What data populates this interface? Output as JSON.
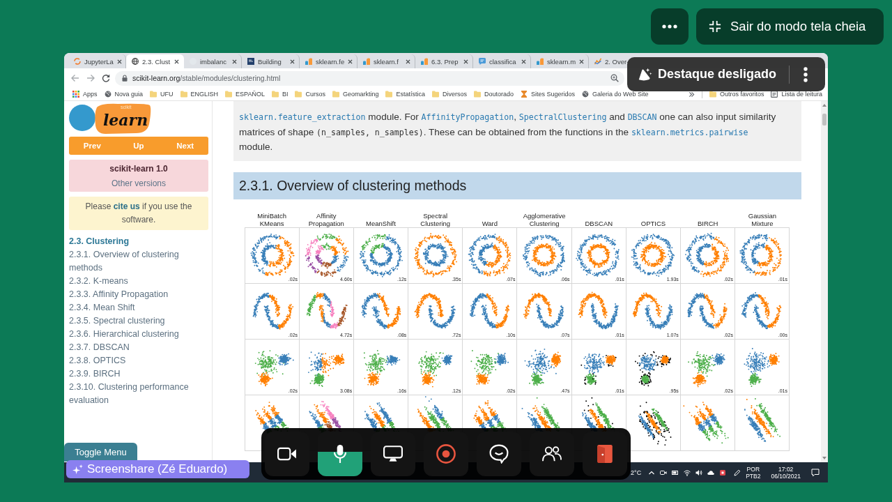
{
  "meeting": {
    "exit_fullscreen": "Sair do modo tela cheia",
    "spotlight": "Destaque desligado",
    "presenter": "Screenshare (Zé Eduardo)",
    "controls": [
      {
        "kind": "camera",
        "on": false
      },
      {
        "kind": "microphone",
        "on": true
      },
      {
        "kind": "screen",
        "on": false
      },
      {
        "kind": "record",
        "on": false
      },
      {
        "kind": "chat",
        "on": false
      },
      {
        "kind": "participants",
        "on": false
      },
      {
        "kind": "leave",
        "on": false
      }
    ]
  },
  "browser": {
    "tabs": [
      {
        "kind": "ring",
        "title": "JupyterLa",
        "selected": false
      },
      {
        "kind": "globe",
        "title": "2.3. Clust",
        "selected": true
      },
      {
        "kind": "disc",
        "title": "imbalanc",
        "selected": false
      },
      {
        "kind": "tile",
        "title": "Building",
        "selected": false
      },
      {
        "kind": "bars",
        "title": "sklearn.fe",
        "selected": false
      },
      {
        "kind": "bars",
        "title": "sklearn.f",
        "selected": false
      },
      {
        "kind": "bars",
        "title": "6.3. Prep",
        "selected": false
      },
      {
        "kind": "bubble",
        "title": "classifica",
        "selected": false
      },
      {
        "kind": "bars",
        "title": "sklearn.m",
        "selected": false
      },
      {
        "kind": "chart",
        "title": "2. Over-",
        "selected": false
      }
    ],
    "address": {
      "domain": "scikit-learn.org",
      "path": "/stable/modules/clustering.html"
    },
    "bookmarks": [
      {
        "kind": "apps",
        "label": "Apps"
      },
      {
        "kind": "globe",
        "label": "Nova guia"
      },
      {
        "kind": "folder",
        "label": "UFU"
      },
      {
        "kind": "folder",
        "label": "ENGLISH"
      },
      {
        "kind": "folder",
        "label": "ESPAÑOL"
      },
      {
        "kind": "folder",
        "label": "BI"
      },
      {
        "kind": "folder",
        "label": "Cursos"
      },
      {
        "kind": "folder",
        "label": "Geomarkting"
      },
      {
        "kind": "folder",
        "label": "Estatística"
      },
      {
        "kind": "folder",
        "label": "Diversos"
      },
      {
        "kind": "folder",
        "label": "Doutorado"
      },
      {
        "kind": "hourglass",
        "label": "Sites Sugeridos"
      },
      {
        "kind": "globe",
        "label": "Galeria do Web Site"
      }
    ],
    "bookmarks_right": [
      {
        "kind": "folder",
        "label": "Outros favoritos"
      },
      {
        "kind": "reading-list",
        "label": "Lista de leitura"
      }
    ]
  },
  "page": {
    "logo": {
      "small": "scikit",
      "name": "learn"
    },
    "nav": [
      "Prev",
      "Up",
      "Next"
    ],
    "version": {
      "title": "scikit-learn 1.0",
      "link": "Other versions"
    },
    "cite": {
      "before": "Please ",
      "link": "cite us",
      "after": " if you use the software."
    },
    "toc": [
      {
        "label": "2.3. Clustering",
        "selected": true,
        "children": [
          {
            "label": "2.3.1. Overview of clustering methods",
            "selected": false
          },
          {
            "label": "2.3.2. K-means",
            "selected": false
          },
          {
            "label": "2.3.3. Affinity Propagation",
            "selected": false
          },
          {
            "label": "2.3.4. Mean Shift",
            "selected": false
          },
          {
            "label": "2.3.5. Spectral clustering",
            "selected": false
          },
          {
            "label": "2.3.6. Hierarchical clustering",
            "selected": false
          },
          {
            "label": "2.3.7. DBSCAN",
            "selected": false
          },
          {
            "label": "2.3.8. OPTICS",
            "selected": false
          },
          {
            "label": "2.3.9. BIRCH",
            "selected": false
          },
          {
            "label": "2.3.10. Clustering performance evaluation",
            "selected": false
          }
        ]
      }
    ],
    "toggle_menu": "Toggle Menu",
    "intro": [
      {
        "kind": "code-link",
        "text": "sklearn.feature_extraction"
      },
      {
        "kind": "text",
        "text": " module. For "
      },
      {
        "kind": "code-link",
        "text": "AffinityPropagation"
      },
      {
        "kind": "text",
        "text": ", "
      },
      {
        "kind": "code-link",
        "text": "SpectralClustering"
      },
      {
        "kind": "text",
        "text": " and "
      },
      {
        "kind": "code-link",
        "text": "DBSCAN"
      },
      {
        "kind": "text",
        "text": " one can also input similarity matrices of shape "
      },
      {
        "kind": "code",
        "text": "(n_samples, n_samples)"
      },
      {
        "kind": "text",
        "text": ". These can be obtained from the functions in the "
      },
      {
        "kind": "code-link",
        "text": "sklearn.metrics.pairwise"
      },
      {
        "kind": "text",
        "text": " module."
      }
    ],
    "section_title": "2.3.1. Overview of clustering methods",
    "comparison": {
      "methods": [
        "MiniBatch KMeans",
        "Affinity Propagation",
        "MeanShift",
        "Spectral Clustering",
        "Ward",
        "Agglomerative Clustering",
        "DBSCAN",
        "OPTICS",
        "BIRCH",
        "Gaussian Mixture"
      ],
      "rows": [
        {
          "kind": "rings",
          "times": [
            ".02s",
            "4.60s",
            ".12s",
            ".35s",
            ".07s",
            ".06s",
            ".01s",
            "1.93s",
            ".02s",
            ".01s"
          ]
        },
        {
          "kind": "moons",
          "times": [
            ".02s",
            "4.72s",
            ".08s",
            ".72s",
            ".10s",
            ".07s",
            ".01s",
            "1.07s",
            ".02s",
            ".00s"
          ]
        },
        {
          "kind": "blobs",
          "times": [
            ".02s",
            "3.08s",
            ".16s",
            ".12s",
            ".02s",
            ".47s",
            ".01s",
            ".95s",
            ".02s",
            ".01s"
          ]
        },
        {
          "kind": "stripes"
        }
      ]
    }
  },
  "taskbar": {
    "weather": "2°C",
    "language": [
      "POR",
      "PTB2"
    ],
    "clock": [
      "17:02",
      "06/10/2021"
    ]
  }
}
